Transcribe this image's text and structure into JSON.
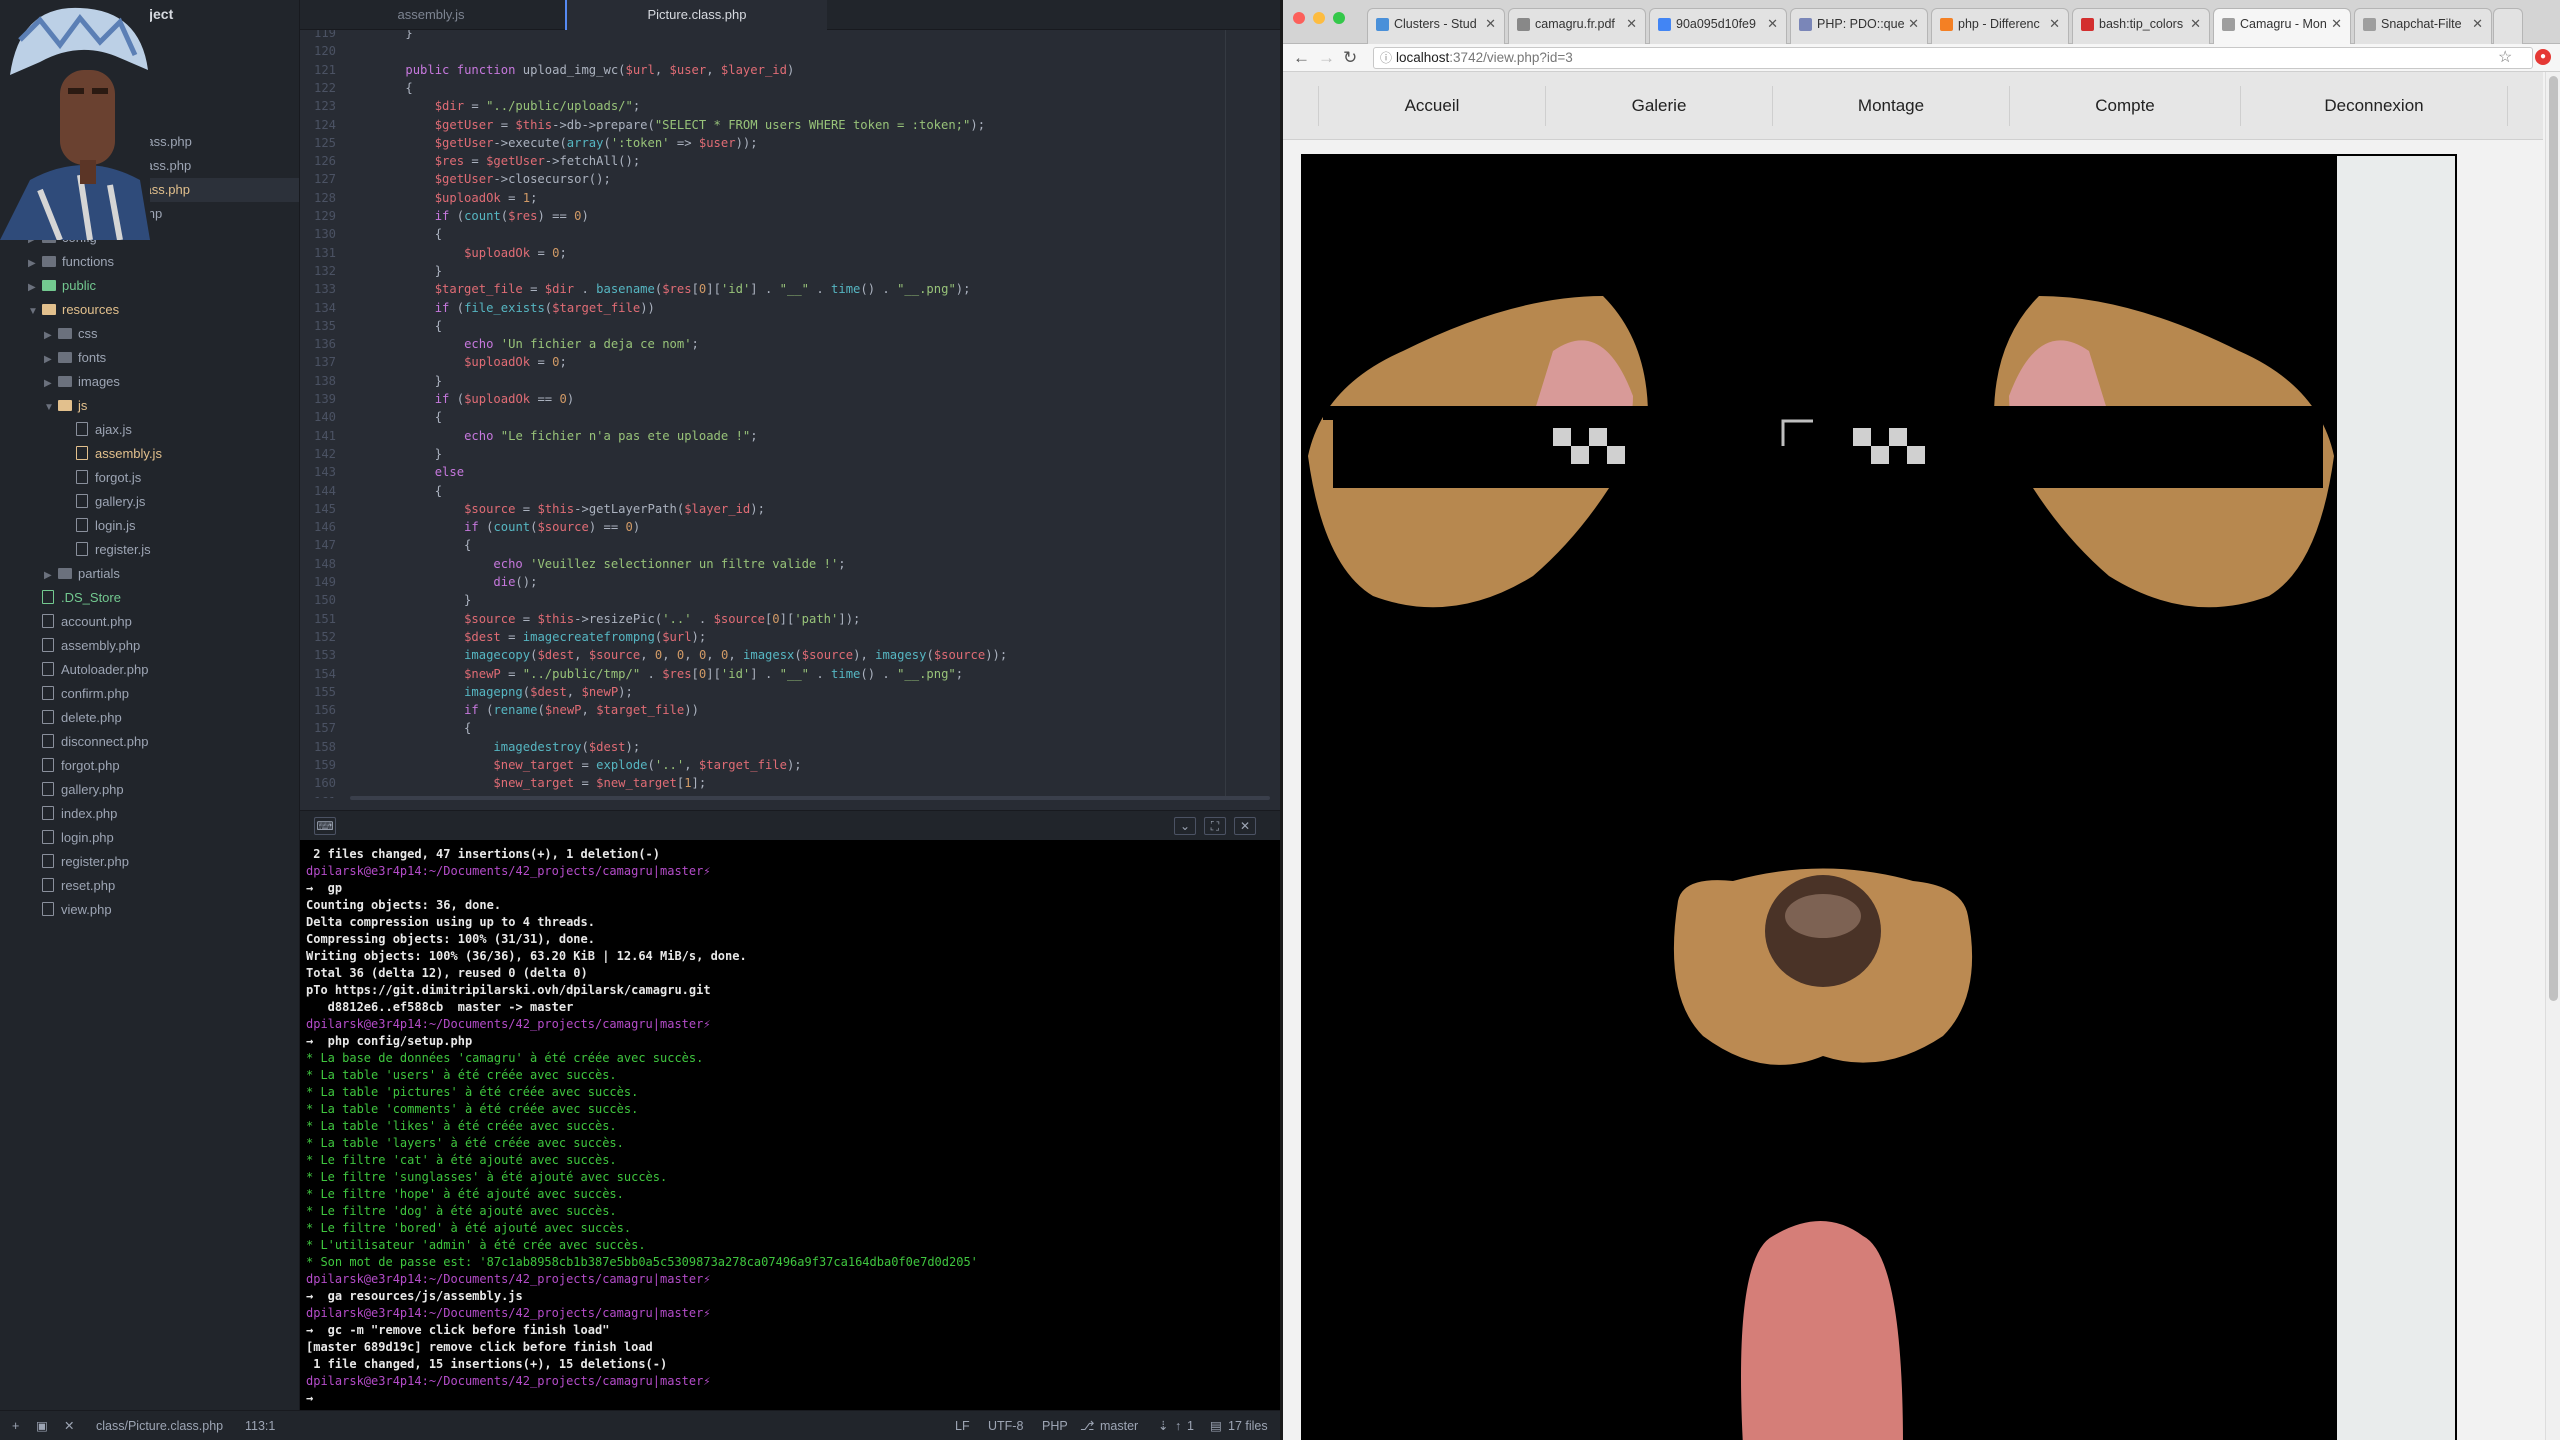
{
  "editor": {
    "project_title": "Project",
    "tabs": [
      "assembly.js",
      "Picture.class.php"
    ],
    "tree": [
      {
        "label": "Comment.class.php",
        "kind": "file",
        "depth": 2,
        "color": ""
      },
      {
        "label": "Database.class.php",
        "kind": "file",
        "depth": 2,
        "color": ""
      },
      {
        "label": "Picture.class.php",
        "kind": "file",
        "depth": 2,
        "color": "orange",
        "selected": true
      },
      {
        "label": "User.class.php",
        "kind": "file",
        "depth": 2,
        "color": ""
      },
      {
        "label": "config",
        "kind": "folder",
        "depth": 1,
        "color": ""
      },
      {
        "label": "functions",
        "kind": "folder",
        "depth": 1,
        "color": ""
      },
      {
        "label": "public",
        "kind": "folder",
        "depth": 1,
        "color": "green"
      },
      {
        "label": "resources",
        "kind": "folder-open",
        "depth": 1,
        "color": "orange"
      },
      {
        "label": "css",
        "kind": "folder",
        "depth": 2,
        "color": ""
      },
      {
        "label": "fonts",
        "kind": "folder",
        "depth": 2,
        "color": ""
      },
      {
        "label": "images",
        "kind": "folder",
        "depth": 2,
        "color": ""
      },
      {
        "label": "js",
        "kind": "folder-open",
        "depth": 2,
        "color": "orange"
      },
      {
        "label": "ajax.js",
        "kind": "file",
        "depth": 3,
        "color": ""
      },
      {
        "label": "assembly.js",
        "kind": "file",
        "depth": 3,
        "color": "orange"
      },
      {
        "label": "forgot.js",
        "kind": "file",
        "depth": 3,
        "color": ""
      },
      {
        "label": "gallery.js",
        "kind": "file",
        "depth": 3,
        "color": ""
      },
      {
        "label": "login.js",
        "kind": "file",
        "depth": 3,
        "color": ""
      },
      {
        "label": "register.js",
        "kind": "file",
        "depth": 3,
        "color": ""
      },
      {
        "label": "partials",
        "kind": "folder",
        "depth": 2,
        "color": ""
      },
      {
        "label": ".DS_Store",
        "kind": "file",
        "depth": 1,
        "color": "green"
      },
      {
        "label": "account.php",
        "kind": "file",
        "depth": 1,
        "color": ""
      },
      {
        "label": "assembly.php",
        "kind": "file",
        "depth": 1,
        "color": ""
      },
      {
        "label": "Autoloader.php",
        "kind": "file",
        "depth": 1,
        "color": ""
      },
      {
        "label": "confirm.php",
        "kind": "file",
        "depth": 1,
        "color": ""
      },
      {
        "label": "delete.php",
        "kind": "file",
        "depth": 1,
        "color": ""
      },
      {
        "label": "disconnect.php",
        "kind": "file",
        "depth": 1,
        "color": ""
      },
      {
        "label": "forgot.php",
        "kind": "file",
        "depth": 1,
        "color": ""
      },
      {
        "label": "gallery.php",
        "kind": "file",
        "depth": 1,
        "color": ""
      },
      {
        "label": "index.php",
        "kind": "file",
        "depth": 1,
        "color": ""
      },
      {
        "label": "login.php",
        "kind": "file",
        "depth": 1,
        "color": ""
      },
      {
        "label": "register.php",
        "kind": "file",
        "depth": 1,
        "color": ""
      },
      {
        "label": "reset.php",
        "kind": "file",
        "depth": 1,
        "color": ""
      },
      {
        "label": "view.php",
        "kind": "file",
        "depth": 1,
        "color": ""
      }
    ],
    "code": [
      {
        "n": "119",
        "t": "    }"
      },
      {
        "n": "120",
        "t": ""
      },
      {
        "n": "121",
        "t": "    public function upload_img_wc($url, $user, $layer_id)"
      },
      {
        "n": "122",
        "t": "    {"
      },
      {
        "n": "123",
        "t": "        $dir = \"../public/uploads/\";"
      },
      {
        "n": "124",
        "t": "        $getUser = $this->db->prepare(\"SELECT * FROM users WHERE token = :token;\");"
      },
      {
        "n": "125",
        "t": "        $getUser->execute(array(':token' => $user));"
      },
      {
        "n": "126",
        "t": "        $res = $getUser->fetchAll();"
      },
      {
        "n": "127",
        "t": "        $getUser->closecursor();"
      },
      {
        "n": "128",
        "t": "        $uploadOk = 1;"
      },
      {
        "n": "129",
        "t": "        if (count($res) == 0)"
      },
      {
        "n": "130",
        "t": "        {"
      },
      {
        "n": "131",
        "t": "            $uploadOk = 0;"
      },
      {
        "n": "132",
        "t": "        }"
      },
      {
        "n": "133",
        "t": "        $target_file = $dir . basename($res[0]['id'] . \"__\" . time() . \"__.png\");"
      },
      {
        "n": "134",
        "t": "        if (file_exists($target_file))"
      },
      {
        "n": "135",
        "t": "        {"
      },
      {
        "n": "136",
        "t": "            echo 'Un fichier a deja ce nom';"
      },
      {
        "n": "137",
        "t": "            $uploadOk = 0;"
      },
      {
        "n": "138",
        "t": "        }"
      },
      {
        "n": "139",
        "t": "        if ($uploadOk == 0)"
      },
      {
        "n": "140",
        "t": "        {"
      },
      {
        "n": "141",
        "t": "            echo \"Le fichier n'a pas ete uploade !\";"
      },
      {
        "n": "142",
        "t": "        }"
      },
      {
        "n": "143",
        "t": "        else"
      },
      {
        "n": "144",
        "t": "        {"
      },
      {
        "n": "145",
        "t": "            $source = $this->getLayerPath($layer_id);"
      },
      {
        "n": "146",
        "t": "            if (count($source) == 0)"
      },
      {
        "n": "147",
        "t": "            {"
      },
      {
        "n": "148",
        "t": "                echo 'Veuillez selectionner un filtre valide !';"
      },
      {
        "n": "149",
        "t": "                die();"
      },
      {
        "n": "150",
        "t": "            }"
      },
      {
        "n": "151",
        "t": "            $source = $this->resizePic('..' . $source[0]['path']);"
      },
      {
        "n": "152",
        "t": "            $dest = imagecreatefrompng($url);"
      },
      {
        "n": "153",
        "t": "            imagecopy($dest, $source, 0, 0, 0, 0, imagesx($source), imagesy($source));"
      },
      {
        "n": "154",
        "t": "            $newP = \"../public/tmp/\" . $res[0]['id'] . \"__\" . time() . \"__.png\";"
      },
      {
        "n": "155",
        "t": "            imagepng($dest, $newP);"
      },
      {
        "n": "156",
        "t": "            if (rename($newP, $target_file))"
      },
      {
        "n": "157",
        "t": "            {"
      },
      {
        "n": "158",
        "t": "                imagedestroy($dest);"
      },
      {
        "n": "159",
        "t": "                $new_target = explode('..', $target_file);"
      },
      {
        "n": "160",
        "t": "                $new_target = $new_target[1];"
      },
      {
        "n": "161",
        "t": ""
      }
    ],
    "terminal": [
      {
        "t": " 2 files changed, 47 insertions(+), 1 deletion(-)",
        "c": "#e8e8e8",
        "b": true
      },
      {
        "t": "dpilarsk@e3r4p14:~/Documents/42_projects/camagru|master⚡",
        "c": "#b44cc9",
        "b": false
      },
      {
        "t": "→  gp",
        "c": "#e8e8e8",
        "b": true
      },
      {
        "t": "Counting objects: 36, done.",
        "c": "#e8e8e8",
        "b": true
      },
      {
        "t": "Delta compression using up to 4 threads.",
        "c": "#e8e8e8",
        "b": true
      },
      {
        "t": "Compressing objects: 100% (31/31), done.",
        "c": "#e8e8e8",
        "b": true
      },
      {
        "t": "Writing objects: 100% (36/36), 63.20 KiB | 12.64 MiB/s, done.",
        "c": "#e8e8e8",
        "b": true
      },
      {
        "t": "Total 36 (delta 12), reused 0 (delta 0)",
        "c": "#e8e8e8",
        "b": true
      },
      {
        "t": "pTo https://git.dimitripilarski.ovh/dpilarsk/camagru.git",
        "c": "#e8e8e8",
        "b": true
      },
      {
        "t": "   d8812e6..ef588cb  master -> master",
        "c": "#e8e8e8",
        "b": true
      },
      {
        "t": "dpilarsk@e3r4p14:~/Documents/42_projects/camagru|master⚡",
        "c": "#b44cc9",
        "b": false
      },
      {
        "t": "→  php config/setup.php",
        "c": "#e8e8e8",
        "b": true
      },
      {
        "t": "* La base de données 'camagru' à été créée avec succès.",
        "c": "#3fc63f",
        "b": false
      },
      {
        "t": "* La table 'users' à été créée avec succès.",
        "c": "#3fc63f",
        "b": false
      },
      {
        "t": "* La table 'pictures' à été créée avec succès.",
        "c": "#3fc63f",
        "b": false
      },
      {
        "t": "* La table 'comments' à été créée avec succès.",
        "c": "#3fc63f",
        "b": false
      },
      {
        "t": "* La table 'likes' à été créée avec succès.",
        "c": "#3fc63f",
        "b": false
      },
      {
        "t": "* La table 'layers' à été créée avec succès.",
        "c": "#3fc63f",
        "b": false
      },
      {
        "t": "* Le filtre 'cat' à été ajouté avec succès.",
        "c": "#3fc63f",
        "b": false
      },
      {
        "t": "* Le filtre 'sunglasses' à été ajouté avec succès.",
        "c": "#3fc63f",
        "b": false
      },
      {
        "t": "* Le filtre 'hope' à été ajouté avec succès.",
        "c": "#3fc63f",
        "b": false
      },
      {
        "t": "* Le filtre 'dog' à été ajouté avec succès.",
        "c": "#3fc63f",
        "b": false
      },
      {
        "t": "* Le filtre 'bored' à été ajouté avec succès.",
        "c": "#3fc63f",
        "b": false
      },
      {
        "t": "* L'utilisateur 'admin' à été crée avec succès.",
        "c": "#3fc63f",
        "b": false
      },
      {
        "t": "* Son mot de passe est: '87c1ab8958cb1b387e5bb0a5c5309873a278ca07496a9f37ca164dba0f0e7d0d205'",
        "c": "#3fc63f",
        "b": false
      },
      {
        "t": "dpilarsk@e3r4p14:~/Documents/42_projects/camagru|master⚡",
        "c": "#b44cc9",
        "b": false
      },
      {
        "t": "→  ga resources/js/assembly.js",
        "c": "#e8e8e8",
        "b": true
      },
      {
        "t": "dpilarsk@e3r4p14:~/Documents/42_projects/camagru|master⚡",
        "c": "#b44cc9",
        "b": false
      },
      {
        "t": "→  gc -m \"remove click before finish load\"",
        "c": "#e8e8e8",
        "b": true
      },
      {
        "t": "[master 689d19c] remove click before finish load",
        "c": "#e8e8e8",
        "b": true
      },
      {
        "t": " 1 file changed, 15 insertions(+), 15 deletions(-)",
        "c": "#e8e8e8",
        "b": true
      },
      {
        "t": "dpilarsk@e3r4p14:~/Documents/42_projects/camagru|master⚡",
        "c": "#b44cc9",
        "b": false
      },
      {
        "t": "→",
        "c": "#e8e8e8",
        "b": true
      }
    ],
    "status": {
      "file": "class/Picture.class.php",
      "pos": "113:1",
      "eol": "LF",
      "enc": "UTF-8",
      "grammar": "PHP",
      "branch": "master",
      "push": "1",
      "files": "17 files"
    }
  },
  "browser": {
    "tabs": [
      {
        "label": "Clusters - Stud",
        "fav": "#4a90d9"
      },
      {
        "label": "camagru.fr.pdf",
        "fav": "#888888"
      },
      {
        "label": "90a095d10fe9",
        "fav": "#4285f4"
      },
      {
        "label": "PHP: PDO::que",
        "fav": "#7a86b8"
      },
      {
        "label": "php - Differenc",
        "fav": "#f48024"
      },
      {
        "label": "bash:tip_colors",
        "fav": "#d32f2f"
      },
      {
        "label": "Camagru - Mon",
        "fav": "#9e9e9e"
      },
      {
        "label": "Snapchat-Filte",
        "fav": "#9e9e9e"
      }
    ],
    "url_host": "localhost",
    "url_rest": ":3742/view.php?id=3",
    "nav": [
      "Accueil",
      "Galerie",
      "Montage",
      "Compte",
      "Deconnexion"
    ]
  },
  "colors": {
    "accent": "#568af2",
    "prompt": "#b44cc9",
    "success": "#3fc63f"
  }
}
